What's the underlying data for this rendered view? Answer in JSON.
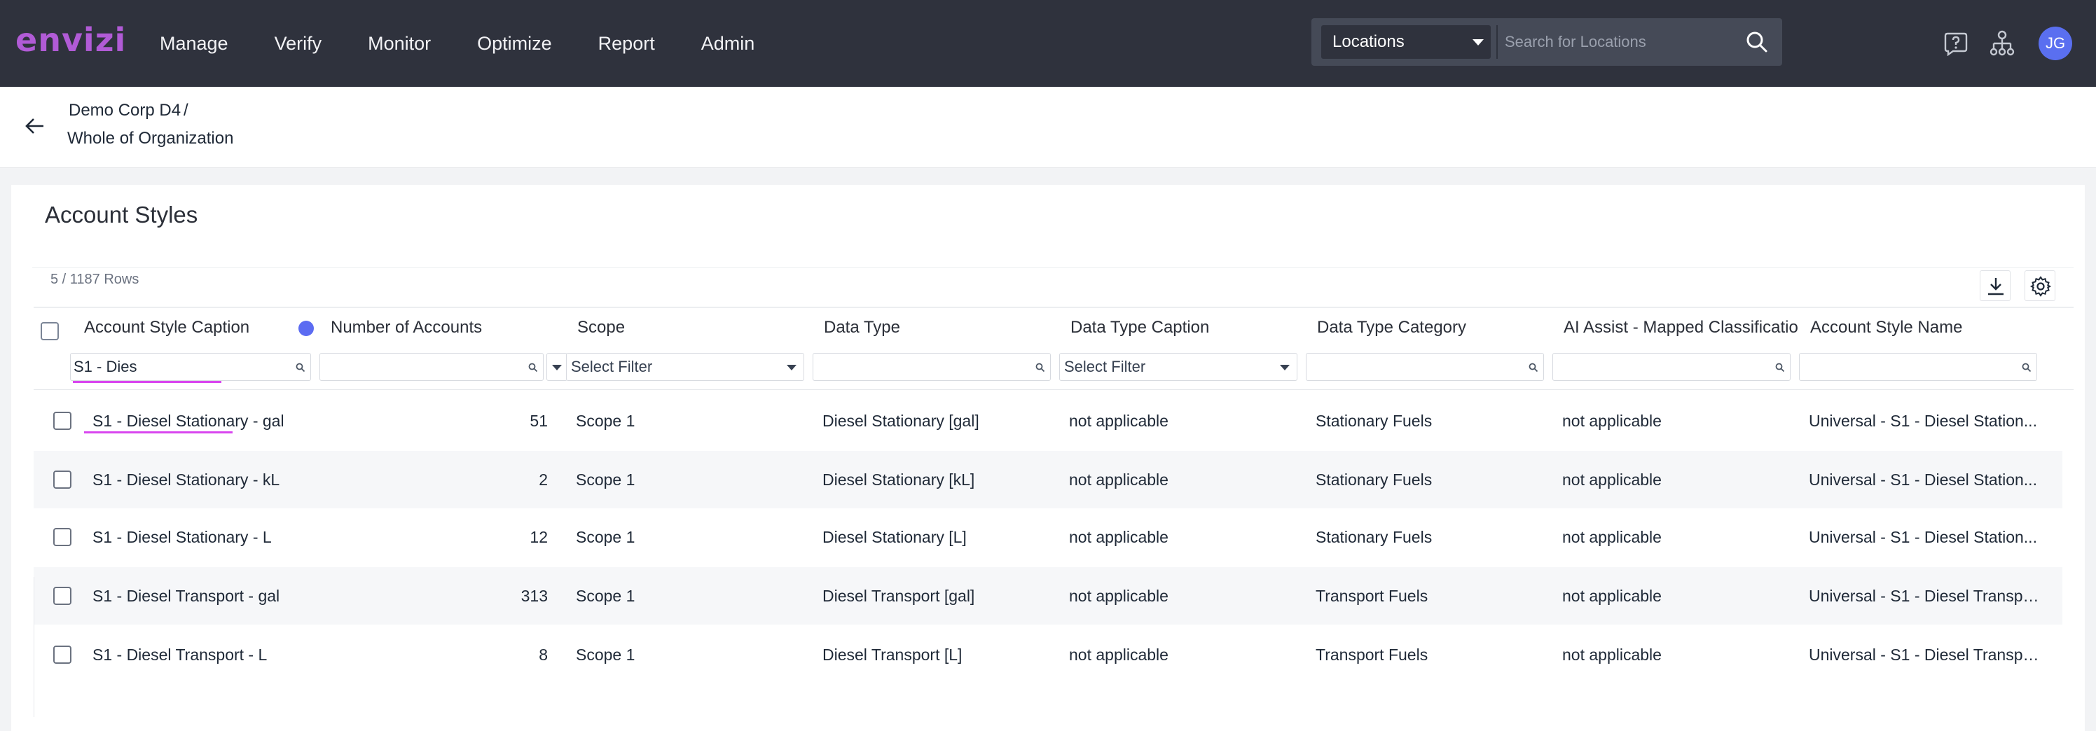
{
  "app": {
    "logo": "envizi",
    "nav": [
      "Manage",
      "Verify",
      "Monitor",
      "Optimize",
      "Report",
      "Admin"
    ],
    "location_select": "Locations",
    "search_placeholder": "Search for Locations",
    "avatar_initials": "JG"
  },
  "breadcrumb": {
    "parent": "Demo Corp D4",
    "separator": "/",
    "current": "Whole of Organization"
  },
  "page": {
    "title": "Account Styles",
    "row_count": "5 / 1187 Rows"
  },
  "table": {
    "columns": [
      "Account Style Caption",
      "Number of Accounts",
      "Scope",
      "Data Type",
      "Data Type Caption",
      "Data Type Category",
      "AI Assist - Mapped Classification",
      "Account Style Name"
    ],
    "filters": {
      "account_style_caption": "S1 - Dies",
      "scope": "Select Filter",
      "data_type_caption": "Select Filter"
    },
    "rows": [
      {
        "caption": "S1 - Diesel Stationary - gal",
        "count": "51",
        "scope": "Scope 1",
        "data_type": "Diesel Stationary [gal]",
        "dt_caption": "not applicable",
        "category": "Stationary Fuels",
        "ai": "not applicable",
        "name": "Universal - S1 - Diesel Station..."
      },
      {
        "caption": "S1 - Diesel Stationary - kL",
        "count": "2",
        "scope": "Scope 1",
        "data_type": "Diesel Stationary [kL]",
        "dt_caption": "not applicable",
        "category": "Stationary Fuels",
        "ai": "not applicable",
        "name": "Universal - S1 - Diesel Station..."
      },
      {
        "caption": "S1 - Diesel Stationary - L",
        "count": "12",
        "scope": "Scope 1",
        "data_type": "Diesel Stationary [L]",
        "dt_caption": "not applicable",
        "category": "Stationary Fuels",
        "ai": "not applicable",
        "name": "Universal - S1 - Diesel Station..."
      },
      {
        "caption": "S1 - Diesel Transport - gal",
        "count": "313",
        "scope": "Scope 1",
        "data_type": "Diesel Transport [gal]",
        "dt_caption": "not applicable",
        "category": "Transport Fuels",
        "ai": "not applicable",
        "name": "Universal - S1 - Diesel Transpo..."
      },
      {
        "caption": "S1 - Diesel Transport - L",
        "count": "8",
        "scope": "Scope 1",
        "data_type": "Diesel Transport [L]",
        "dt_caption": "not applicable",
        "category": "Transport Fuels",
        "ai": "not applicable",
        "name": "Universal - S1 - Diesel Transpo..."
      }
    ]
  },
  "colors": {
    "topbar": "#2f323d",
    "logo": "#b15bd6",
    "accent_dot": "#5c6cf2",
    "highlight_underline": "#d946ef",
    "avatar": "#5a6ff0"
  }
}
